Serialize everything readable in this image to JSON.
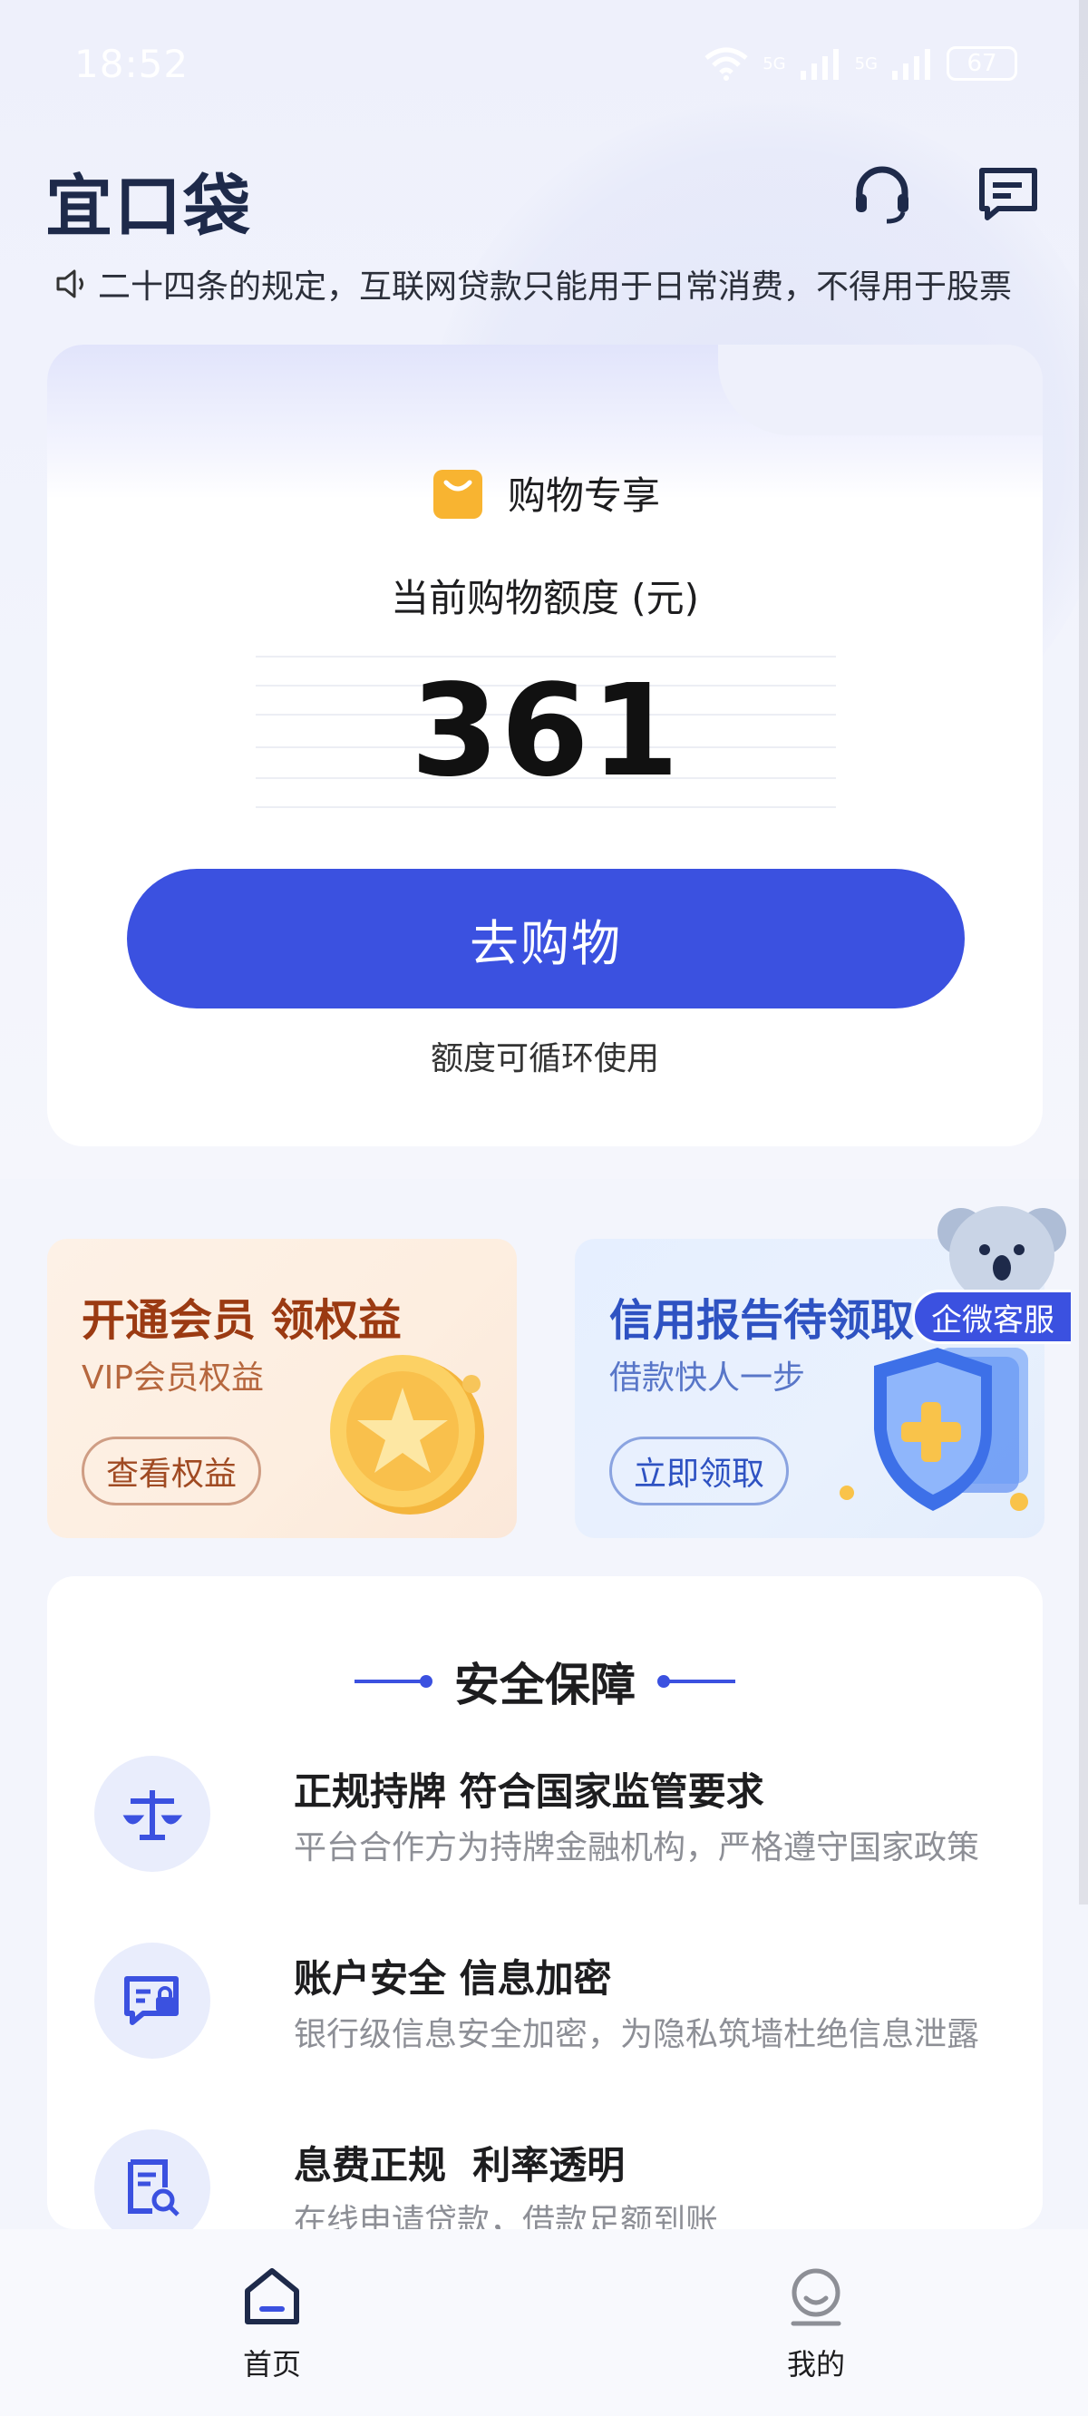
{
  "status_bar": {
    "time": "18:52",
    "network": "5G",
    "battery": "67"
  },
  "header": {
    "logo": "宜口袋"
  },
  "notice": {
    "text": "二十四条的规定，互联网贷款只能用于日常消费，不得用于股票"
  },
  "credit_card": {
    "tag": "购物专享",
    "limit_label": "当前购物额度 (元)",
    "amount": "361",
    "button": "去购物",
    "note": "额度可循环使用"
  },
  "promos": [
    {
      "title": "开通会员 领权益",
      "subtitle": "VIP会员权益",
      "button": "查看权益"
    },
    {
      "title": "信用报告待领取",
      "subtitle": "借款快人一步",
      "button": "立即领取"
    }
  ],
  "customer_service": {
    "label": "企微客服"
  },
  "security": {
    "title": "安全保障",
    "items": [
      {
        "title": "正规持牌 符合国家监管要求",
        "desc": "平台合作方为持牌金融机构，严格遵守国家政策",
        "icon": "scale-icon"
      },
      {
        "title": "账户安全 信息加密",
        "desc": "银行级信息安全加密，为隐私筑墙杜绝信息泄露",
        "icon": "secure-chat-icon"
      },
      {
        "title": "息费正规  利率透明",
        "desc": "在线申请贷款，借款足额到账",
        "icon": "document-search-icon"
      }
    ]
  },
  "tabbar": {
    "home": "首页",
    "mine": "我的"
  },
  "colors": {
    "primary": "#3b51e0",
    "vip_text": "#9b3a12",
    "credit_text": "#2e52c2"
  }
}
